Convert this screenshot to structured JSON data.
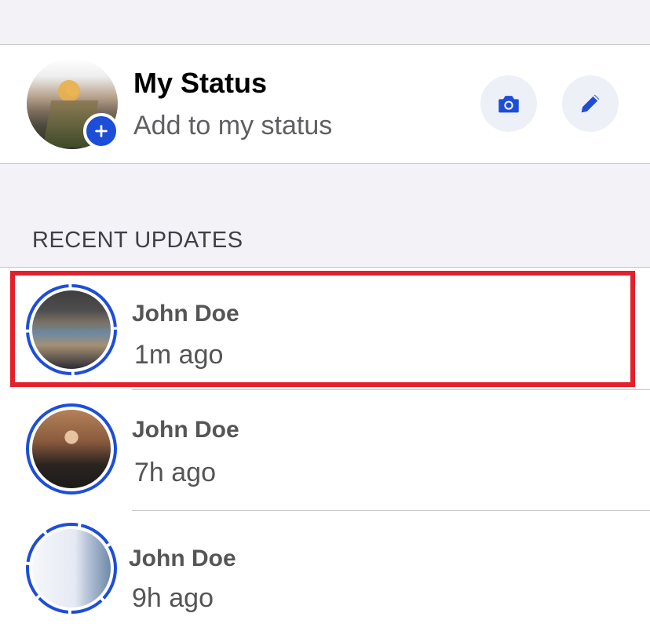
{
  "my_status": {
    "title": "My Status",
    "subtitle": "Add to my status",
    "camera_icon": "camera-icon",
    "edit_icon": "pencil-icon",
    "add_icon": "plus-icon"
  },
  "recent": {
    "section_label": "RECENT UPDATES",
    "items": [
      {
        "name": "John Doe",
        "time": "1m ago"
      },
      {
        "name": "John Doe",
        "time": "7h ago"
      },
      {
        "name": "John Doe",
        "time": "9h ago"
      }
    ]
  },
  "colors": {
    "accent": "#1d4ed8",
    "highlight": "#e3202c",
    "background": "#f2f2f7"
  }
}
